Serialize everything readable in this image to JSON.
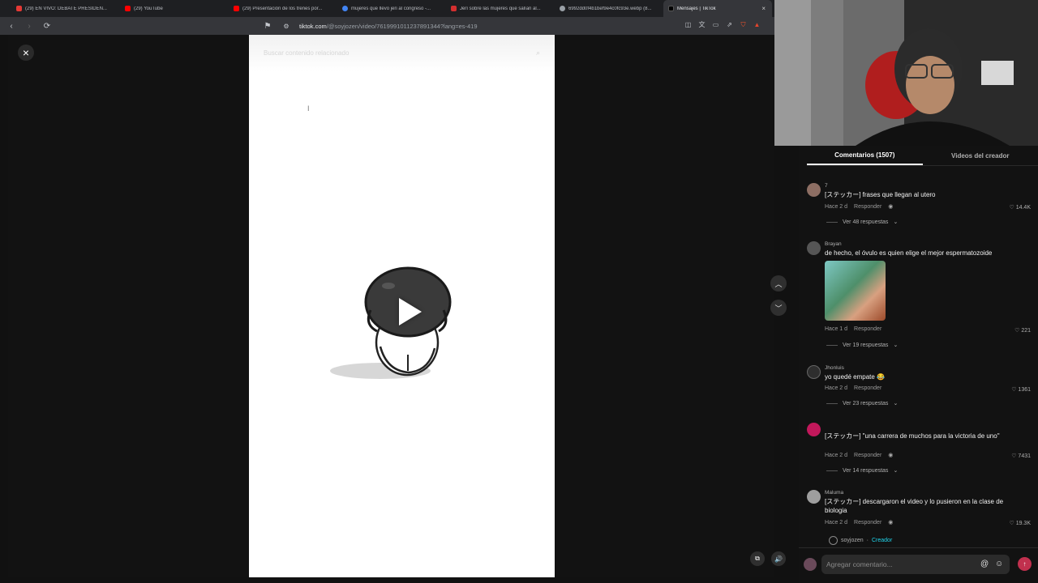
{
  "browser": {
    "tabs": [
      {
        "label": "(29) EN VIVO: DEBATE PRESIDEN...",
        "favicon_color": "#e53935",
        "active": false
      },
      {
        "label": "(29) YouTube",
        "favicon_color": "#ff0000",
        "active": false
      },
      {
        "label": "(29) Presentación de los trenes por...",
        "favicon_color": "#ff0000",
        "active": false
      },
      {
        "label": "mujeres que llevo jeri al congreso -...",
        "favicon_color": "#4285f4",
        "active": false
      },
      {
        "label": "Jerí sobre las mujeres que salían al...",
        "favicon_color": "#d32f2f",
        "active": false
      },
      {
        "label": "6992dd0f4b1bef9e4c0fc93e.webp (8...",
        "favicon_color": "#9aa0a6",
        "active": false
      },
      {
        "label": "Mensajes | TikTok",
        "favicon_color": "#000000",
        "active": true
      }
    ],
    "active_tab_close": "×",
    "url_host": "tiktok.com",
    "url_path": "/@soyjozen/video/7619991011237891344?lang=es-419"
  },
  "player": {
    "close_label": "×",
    "search_placeholder": "Buscar contenido relacionado",
    "colors": {
      "video_bg": "#ffffff",
      "accent": "#fe2c55"
    }
  },
  "panel": {
    "tabs": [
      {
        "label": "Comentarios (1507)",
        "active": true
      },
      {
        "label": "Videos del creador",
        "active": false
      }
    ],
    "comments": [
      {
        "user": "7",
        "text": "[ステッカー] frases que llegan al utero",
        "time": "Hace 2 d",
        "reply": "Responder",
        "likes": "14.4K",
        "replies": "Ver 48 respuestas"
      },
      {
        "user": "Brayan",
        "text": "de hecho, el óvulo es quien elige el mejor espermatozoide",
        "time": "Hace 1 d",
        "reply": "Responder",
        "likes": "221",
        "replies": "Ver 19 respuestas"
      },
      {
        "user": "Jhonluis",
        "text": "yo quedé empate 😂",
        "time": "Hace 2 d",
        "reply": "Responder",
        "likes": "1361",
        "replies": "Ver 23 respuestas"
      },
      {
        "user": "",
        "text": "[ステッカー] \"una carrera de muchos para la victoria de uno\"",
        "time": "Hace 2 d",
        "reply": "Responder",
        "likes": "7431",
        "replies": "Ver 14 respuestas"
      },
      {
        "user": "Maluma",
        "text": "[ステッカー] descargaron el video y lo pusieron en la clase de biologia",
        "time": "Hace 2 d",
        "reply": "Responder",
        "likes": "19.3K",
        "replies": ""
      }
    ],
    "creator_reply": {
      "user": "soyjozen",
      "separator": "·",
      "tag": "Creador"
    },
    "input_placeholder": "Agregar comentario...",
    "mention_symbol": "@",
    "emoji_symbol": "☺",
    "send_symbol": "↑"
  }
}
